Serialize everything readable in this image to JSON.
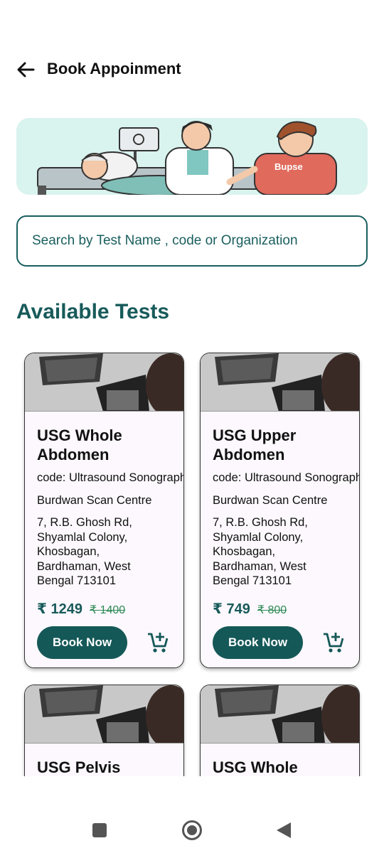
{
  "header": {
    "title": "Book Appoinment",
    "back_icon": "arrow-left-icon"
  },
  "banner": {
    "shirt_text": "Bupse"
  },
  "search": {
    "placeholder": "Search by Test Name , code or Organization"
  },
  "section": {
    "title": "Available Tests"
  },
  "tests": [
    {
      "name": "USG Whole Abdomen",
      "code": "code: Ultrasound Sonography",
      "organization": "Burdwan Scan Centre",
      "address": "7, R.B. Ghosh Rd, Shyamlal Colony, Khosbagan, Bardhaman, West Bengal 713101",
      "price": "₹ 1249",
      "old_price": "₹ 1400",
      "book_label": "Book Now"
    },
    {
      "name": "USG Upper Abdomen",
      "code": "code: Ultrasound  Sonography",
      "organization": "Burdwan Scan Centre",
      "address": "7, R.B. Ghosh Rd, Shyamlal Colony, Khosbagan, Bardhaman, West Bengal 713101",
      "price": "₹ 749",
      "old_price": "₹ 800",
      "book_label": "Book Now"
    },
    {
      "name": "USG Pelvis"
    },
    {
      "name": "USG Whole"
    }
  ],
  "colors": {
    "primary": "#155858",
    "accent": "#2e8b57",
    "banner_bg": "#d9f3ee",
    "card_bg": "#fcf8fd"
  }
}
